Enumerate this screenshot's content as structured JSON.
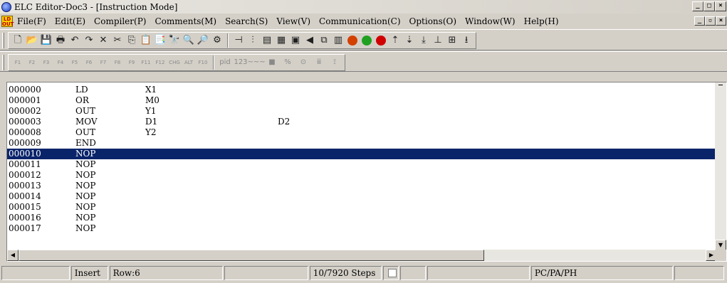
{
  "window": {
    "title": "ELC Editor-Doc3 - [Instruction Mode]",
    "controls": [
      "_",
      "□",
      "×"
    ],
    "mdi_controls": [
      "_",
      "▫",
      "×"
    ]
  },
  "menu": {
    "app_icon": "LD OUT",
    "items": [
      "File(F)",
      "Edit(E)",
      "Compiler(P)",
      "Comments(M)",
      "Search(S)",
      "View(V)",
      "Communication(C)",
      "Options(O)",
      "Window(W)",
      "Help(H)"
    ]
  },
  "toolbar1": {
    "icons": [
      {
        "name": "new-file-icon",
        "glyph": "🗋"
      },
      {
        "name": "open-folder-icon",
        "glyph": "📂"
      },
      {
        "name": "save-icon",
        "glyph": "💾"
      },
      {
        "name": "print-icon",
        "glyph": "🖶"
      },
      {
        "name": "undo-icon",
        "glyph": "↶"
      },
      {
        "name": "redo-icon",
        "glyph": "↷"
      },
      {
        "name": "delete-icon",
        "glyph": "✕"
      },
      {
        "name": "cut-icon",
        "glyph": "✂"
      },
      {
        "name": "copy-icon",
        "glyph": "⎘"
      },
      {
        "name": "paste-icon",
        "glyph": "📋"
      },
      {
        "name": "paste-special-icon",
        "glyph": "📑"
      },
      {
        "name": "find-icon",
        "glyph": "🔭"
      },
      {
        "name": "zoom-in-icon",
        "glyph": "🔍"
      },
      {
        "name": "zoom-out-icon",
        "glyph": "🔎"
      },
      {
        "name": "settings-icon",
        "glyph": "⚙"
      }
    ],
    "icons2": [
      {
        "name": "output-end-icon",
        "glyph": "⊣"
      },
      {
        "name": "ladder-icon",
        "glyph": "⫶"
      },
      {
        "name": "instruction-icon",
        "glyph": "▤"
      },
      {
        "name": "sfc-icon",
        "glyph": "▦"
      },
      {
        "name": "table-icon",
        "glyph": "▣"
      },
      {
        "name": "back-icon",
        "glyph": "◀"
      },
      {
        "name": "monitor-icon",
        "glyph": "⧉"
      },
      {
        "name": "device-icon",
        "glyph": "▥"
      }
    ],
    "status_dots": [
      {
        "name": "online-icon",
        "color": "#d44000",
        "label": "ON"
      },
      {
        "name": "run-icon",
        "color": "#20a020",
        "label": "RUN"
      },
      {
        "name": "stop-icon",
        "color": "#d00000",
        "label": "STOP"
      }
    ],
    "icons3": [
      {
        "name": "upload-icon",
        "glyph": "⇡"
      },
      {
        "name": "download-icon",
        "glyph": "⇣"
      },
      {
        "name": "transfer-icon",
        "glyph": "⤓"
      },
      {
        "name": "code-icon",
        "glyph": "⊥"
      },
      {
        "name": "binary-icon",
        "glyph": "⊞"
      },
      {
        "name": "plc-write-icon",
        "glyph": "⭳"
      }
    ]
  },
  "toolbar2": {
    "icons": [
      "F1",
      "F2",
      "F3",
      "F4",
      "F5",
      "F6",
      "F7",
      "F8",
      "F9",
      "F11",
      "F12",
      "CHG",
      "ALT",
      "F10"
    ],
    "extras": [
      "pid",
      "123",
      "~~~",
      "■",
      "%",
      "⊙",
      "ⅲ",
      "⟟"
    ]
  },
  "editor": {
    "lines": [
      {
        "step": "000000",
        "op": "LD",
        "a1": "X1",
        "a2": ""
      },
      {
        "step": "000001",
        "op": "OR",
        "a1": "M0",
        "a2": ""
      },
      {
        "step": "000002",
        "op": "OUT",
        "a1": "Y1",
        "a2": ""
      },
      {
        "step": "000003",
        "op": "MOV",
        "a1": "D1",
        "a2": "D2"
      },
      {
        "step": "000008",
        "op": "OUT",
        "a1": "Y2",
        "a2": ""
      },
      {
        "step": "000009",
        "op": "END",
        "a1": "",
        "a2": ""
      },
      {
        "step": "000010",
        "op": "NOP",
        "a1": "",
        "a2": ""
      },
      {
        "step": "000011",
        "op": "NOP",
        "a1": "",
        "a2": ""
      },
      {
        "step": "000012",
        "op": "NOP",
        "a1": "",
        "a2": ""
      },
      {
        "step": "000013",
        "op": "NOP",
        "a1": "",
        "a2": ""
      },
      {
        "step": "000014",
        "op": "NOP",
        "a1": "",
        "a2": ""
      },
      {
        "step": "000015",
        "op": "NOP",
        "a1": "",
        "a2": ""
      },
      {
        "step": "000016",
        "op": "NOP",
        "a1": "",
        "a2": ""
      },
      {
        "step": "000017",
        "op": "NOP",
        "a1": "",
        "a2": ""
      }
    ],
    "selected_index": 6,
    "selection_color": "#0a246a"
  },
  "statusbar": {
    "panels": [
      "",
      "Insert",
      "Row:6",
      "",
      "10/7920 Steps",
      "",
      "",
      "",
      "PC/PA/PH",
      ""
    ]
  }
}
